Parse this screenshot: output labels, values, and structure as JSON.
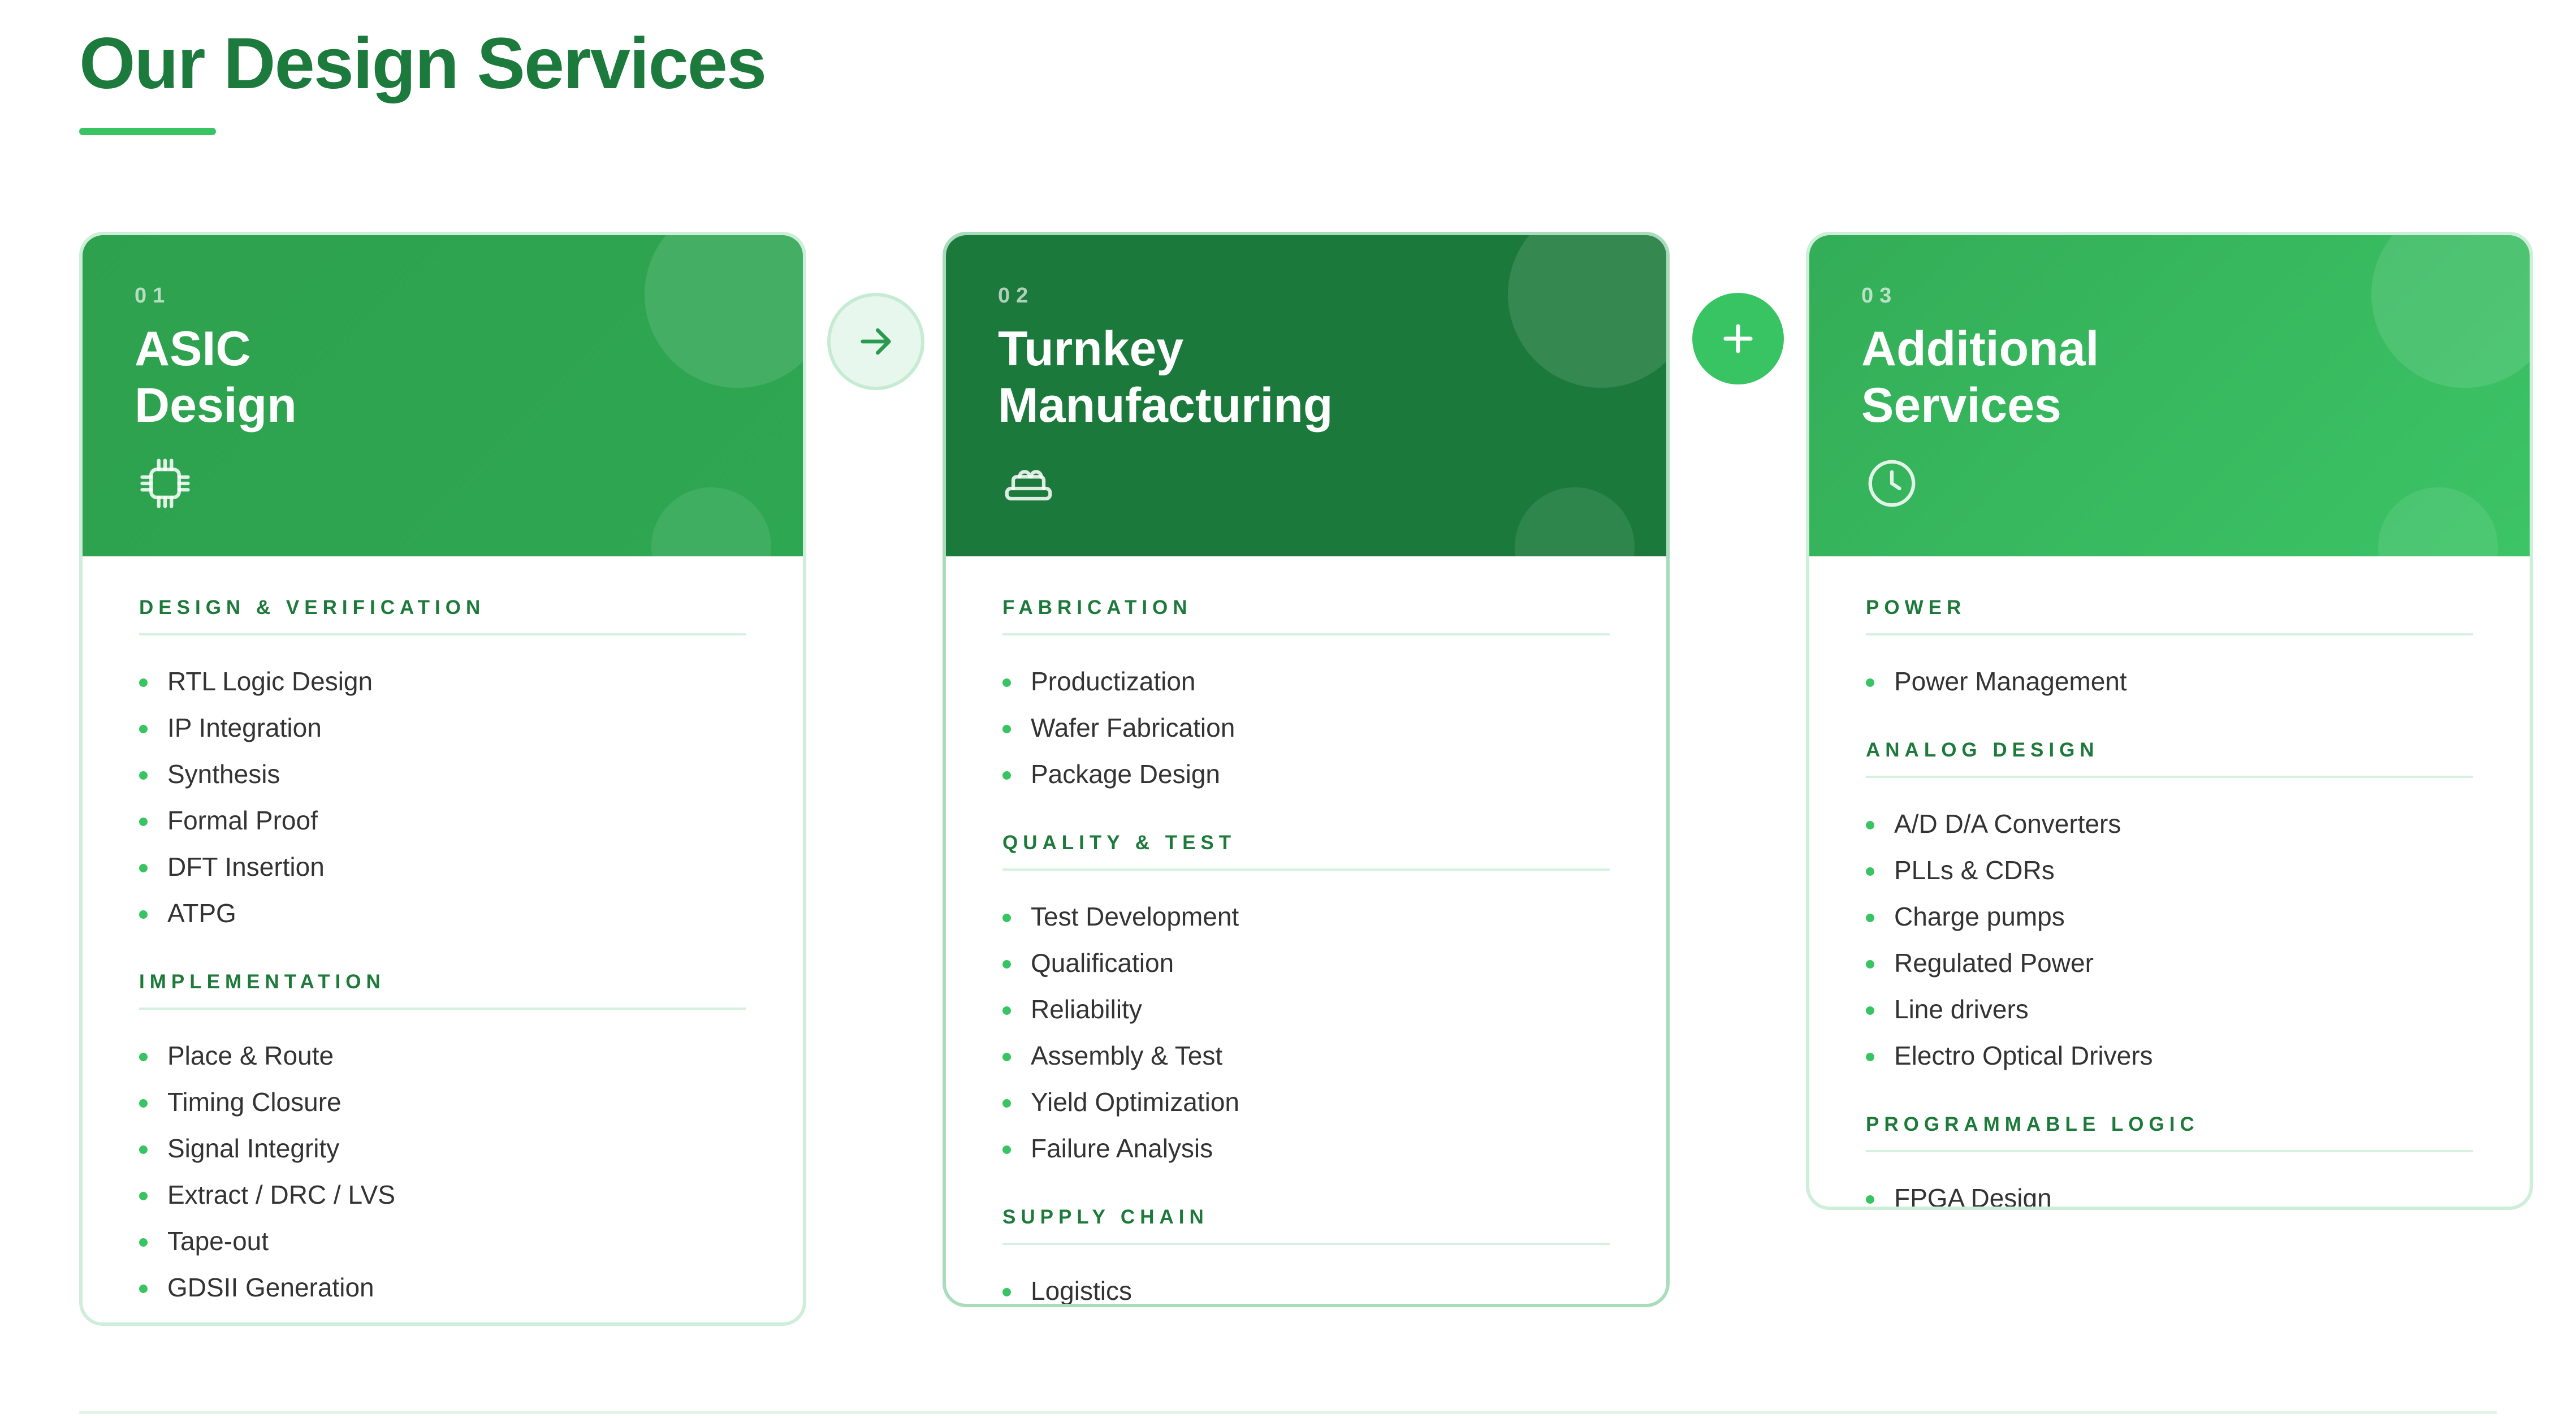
{
  "page": {
    "title": "Our Design Services"
  },
  "colors": {
    "accent": "#38c463",
    "title": "#1c7a3c",
    "card1_header": "#2ea14e",
    "card2_header": "#1b7a3b",
    "card3_header": "#3cc466"
  },
  "connectors": [
    {
      "icon": "arrow-right-icon"
    },
    {
      "icon": "plus-icon"
    }
  ],
  "cards": [
    {
      "number": "01",
      "title_line1": "ASIC",
      "title_line2": "Design",
      "icon": "chip-icon",
      "sections": [
        {
          "heading": "DESIGN & VERIFICATION",
          "items": [
            "RTL Logic Design",
            "IP Integration",
            "Synthesis",
            "Formal Proof",
            "DFT Insertion",
            "ATPG"
          ]
        },
        {
          "heading": "IMPLEMENTATION",
          "items": [
            "Place & Route",
            "Timing Closure",
            "Signal Integrity",
            "Extract / DRC / LVS",
            "Tape-out",
            "GDSII Generation"
          ]
        }
      ]
    },
    {
      "number": "02",
      "title_line1": "Turnkey",
      "title_line2": "Manufacturing",
      "icon": "factory-icon",
      "sections": [
        {
          "heading": "FABRICATION",
          "items": [
            "Productization",
            "Wafer Fabrication",
            "Package Design"
          ]
        },
        {
          "heading": "QUALITY & TEST",
          "items": [
            "Test Development",
            "Qualification",
            "Reliability",
            "Assembly & Test",
            "Yield Optimization",
            "Failure Analysis"
          ]
        },
        {
          "heading": "SUPPLY CHAIN",
          "items": [
            "Logistics"
          ]
        }
      ]
    },
    {
      "number": "03",
      "title_line1": "Additional",
      "title_line2": "Services",
      "icon": "clock-icon",
      "sections": [
        {
          "heading": "POWER",
          "items": [
            "Power Management"
          ]
        },
        {
          "heading": "ANALOG DESIGN",
          "items": [
            "A/D D/A Converters",
            "PLLs & CDRs",
            "Charge pumps",
            "Regulated Power",
            "Line drivers",
            "Electro Optical Drivers"
          ]
        },
        {
          "heading": "PROGRAMMABLE LOGIC",
          "items": [
            "FPGA Design"
          ]
        }
      ]
    }
  ]
}
